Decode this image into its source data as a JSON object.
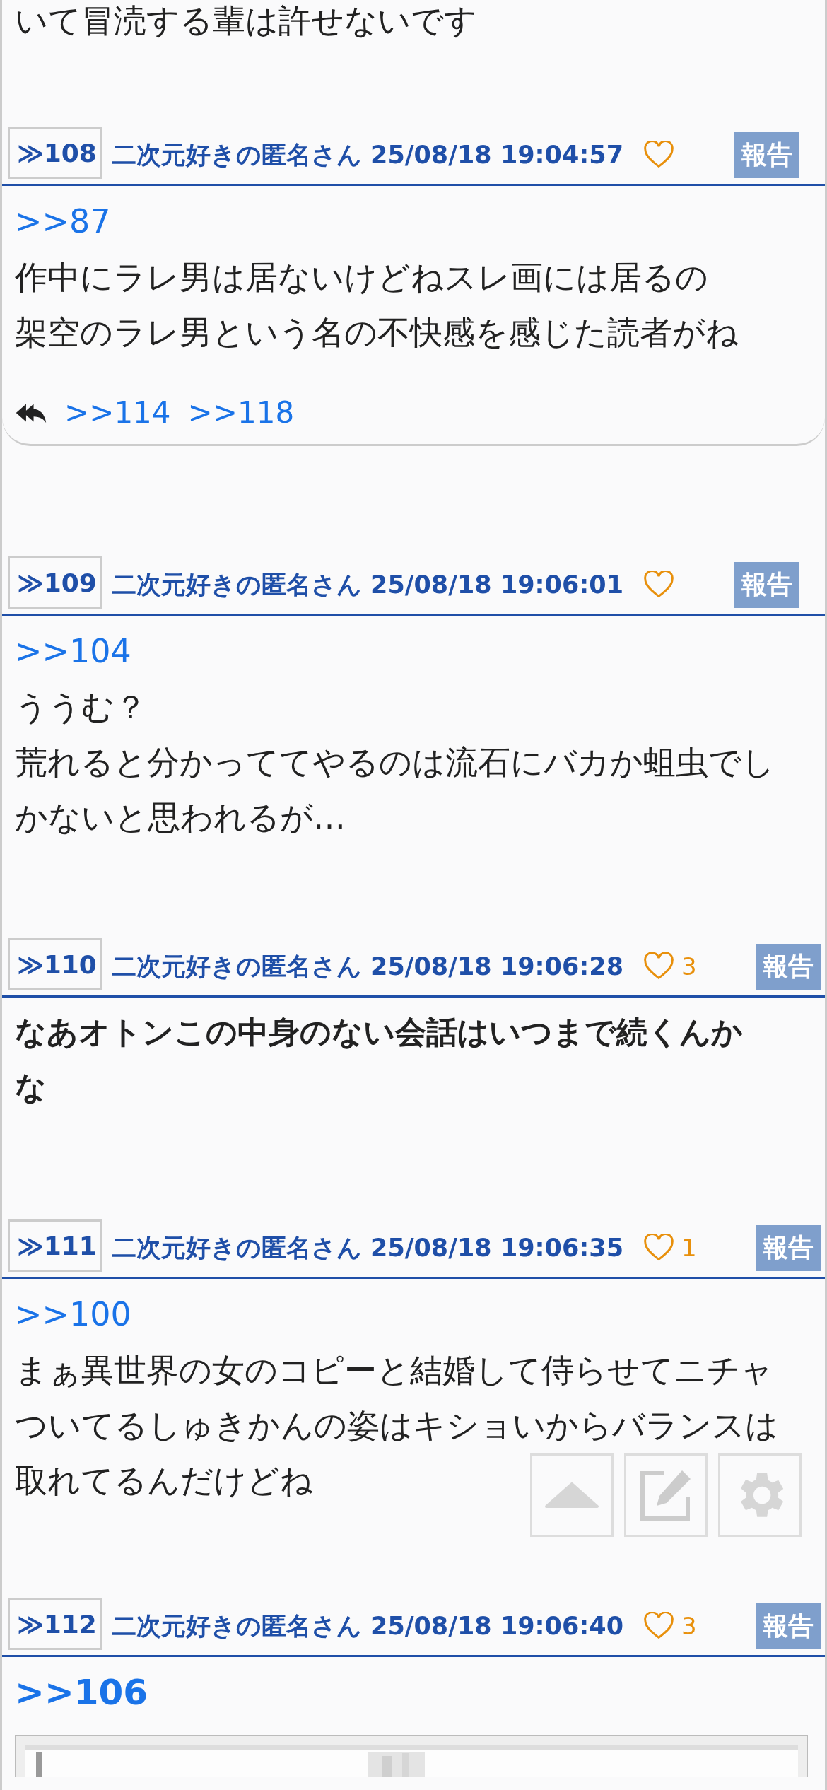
{
  "top_fragment": "いて冒涜する輩は許せないです",
  "posts": [
    {
      "number": "≫108",
      "name": "二次元好きの匿名さん",
      "date": "25/08/18 19:04:57",
      "report": "報告",
      "anchor": {
        "label": ">>87",
        "large": false
      },
      "lines": [
        "作中にラレ男は居ないけどねスレ画には居るの",
        "架空のラレ男という名の不快感を感じた読者がね"
      ],
      "bold": false,
      "replies": [
        ">>114",
        ">>118"
      ]
    },
    {
      "number": "≫109",
      "name": "二次元好きの匿名さん",
      "date": "25/08/18 19:06:01",
      "report": "報告",
      "anchor": {
        "label": ">>104",
        "large": false
      },
      "lines": [
        "ううむ？",
        "荒れると分かっててやるのは流石にバカか蛆虫でし",
        "かないと思われるが…"
      ],
      "bold": false
    },
    {
      "number": "≫110",
      "name": "二次元好きの匿名さん",
      "date": "25/08/18 19:06:28",
      "likes": "3",
      "report": "報告",
      "lines": [
        "なあオトンこの中身のない会話はいつまで続くんか",
        "な"
      ],
      "bold": true
    },
    {
      "number": "≫111",
      "name": "二次元好きの匿名さん",
      "date": "25/08/18 19:06:35",
      "likes": "1",
      "report": "報告",
      "anchor": {
        "label": ">>100",
        "large": false
      },
      "lines": [
        "まぁ異世界の女のコピーと結婚して侍らせてニチャ",
        "ついてるしゅきかんの姿はキショいからバランスは",
        "取れてるんだけどね"
      ],
      "bold": false
    },
    {
      "number": "≫112",
      "name": "二次元好きの匿名さん",
      "date": "25/08/18 19:06:40",
      "likes": "3",
      "report": "報告",
      "anchor": {
        "label": ">>106",
        "large": true
      },
      "bold": false
    }
  ],
  "float_buttons": [
    {
      "kind": "up"
    },
    {
      "kind": "edit"
    },
    {
      "kind": "settings"
    }
  ]
}
